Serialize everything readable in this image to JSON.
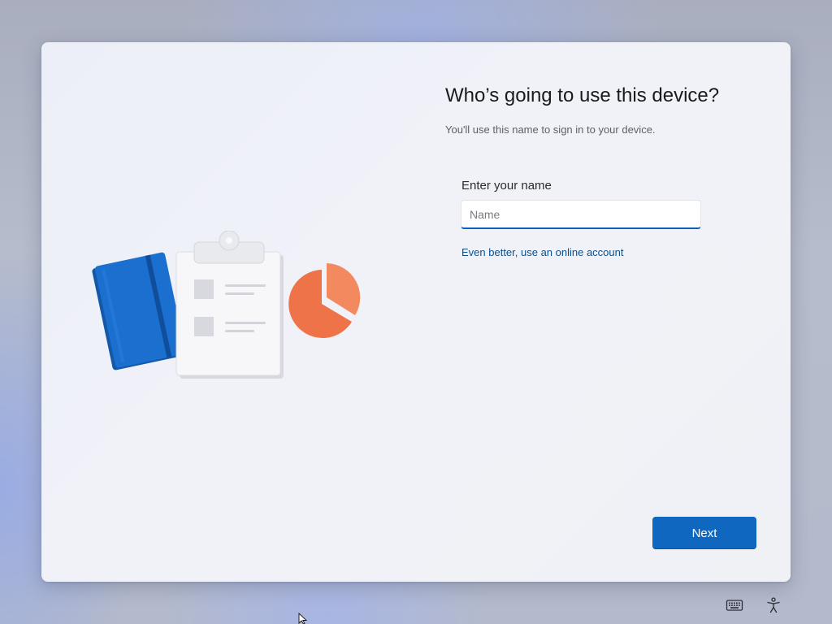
{
  "setup": {
    "title": "Who’s going to use this device?",
    "subtitle": "You'll use this name to sign in to your device.",
    "name_field": {
      "label": "Enter your name",
      "placeholder": "Name",
      "value": ""
    },
    "online_account_link": "Even better, use an online account",
    "next_label": "Next"
  },
  "illustration": {
    "icons": [
      "notebook-icon",
      "clipboard-icon",
      "pie-chart-icon"
    ]
  },
  "taskbar": {
    "icons": [
      "keyboard-icon",
      "accessibility-icon"
    ]
  },
  "colors": {
    "accent": "#0f67c0",
    "link": "#0b4f8c",
    "notebook": "#1565c0",
    "pie_chart": "#f07a4f"
  }
}
